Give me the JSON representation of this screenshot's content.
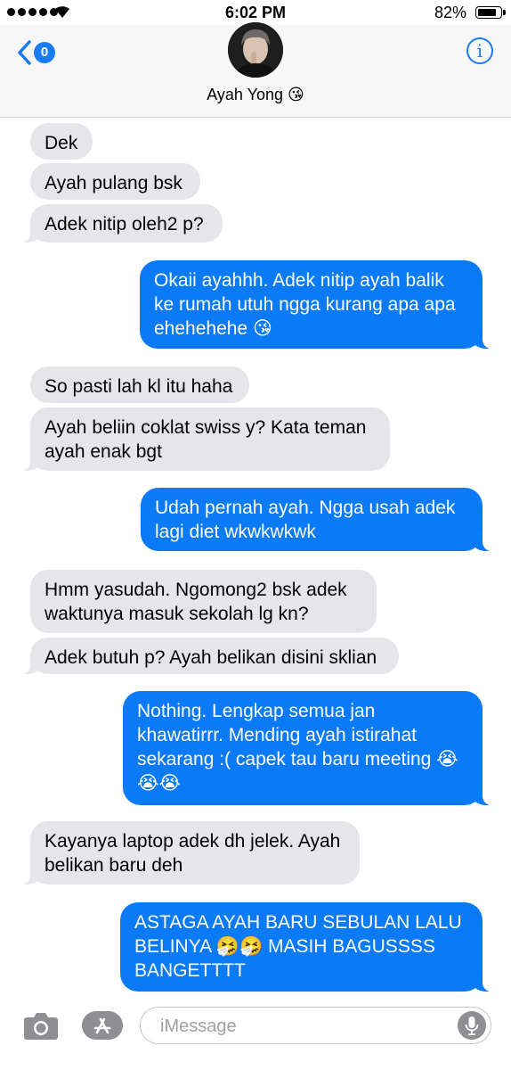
{
  "status_bar": {
    "time": "6:02 PM",
    "battery": "82%"
  },
  "header": {
    "back_badge": "0",
    "contact_name": "Ayah Yong",
    "contact_emoji": "😘",
    "info_label": "i"
  },
  "messages": [
    {
      "from": "in",
      "text": "Dek"
    },
    {
      "from": "in",
      "text": "Ayah pulang bsk"
    },
    {
      "from": "in",
      "text": "Adek nitip oleh2 p?"
    },
    {
      "from": "out",
      "text": "Okaii ayahhh. Adek nitip ayah balik\nke rumah utuh ngga kurang apa apa\nehehehehe 😘"
    },
    {
      "from": "in",
      "text": "So pasti lah kl itu haha"
    },
    {
      "from": "in",
      "text": "Ayah beliin coklat swiss y? Kata teman\nayah enak bgt"
    },
    {
      "from": "out",
      "text": "Udah pernah ayah. Ngga usah adek\nlagi diet wkwkwkwk"
    },
    {
      "from": "in",
      "text": "Hmm yasudah. Ngomong2 bsk adek\nwaktunya masuk sekolah lg kn?"
    },
    {
      "from": "in",
      "text": "Adek butuh p? Ayah belikan disini sklian"
    },
    {
      "from": "out",
      "text": "Nothing. Lengkap semua jan\nkhawatirrr. Mending ayah istirahat\nsekarang :( capek tau baru meeting 😭\n😭😭"
    },
    {
      "from": "in",
      "text": "Kayanya laptop adek dh jelek. Ayah\nbelikan baru deh"
    },
    {
      "from": "out",
      "text": "ASTAGA AYAH BARU SEBULAN LALU\nBELINYA 🤧🤧 MASIH BAGUSSSS\nBANGETTTT"
    }
  ],
  "input_bar": {
    "placeholder": "iMessage"
  },
  "icons": {
    "back": "chevron-left-icon",
    "info": "info-icon",
    "camera": "camera-icon",
    "apps": "app-store-icon",
    "mic": "microphone-icon"
  },
  "colors": {
    "accent": "#1a7cf5",
    "outgoing_bubble": "#0b7af7",
    "incoming_bubble": "#e5e5ea"
  }
}
